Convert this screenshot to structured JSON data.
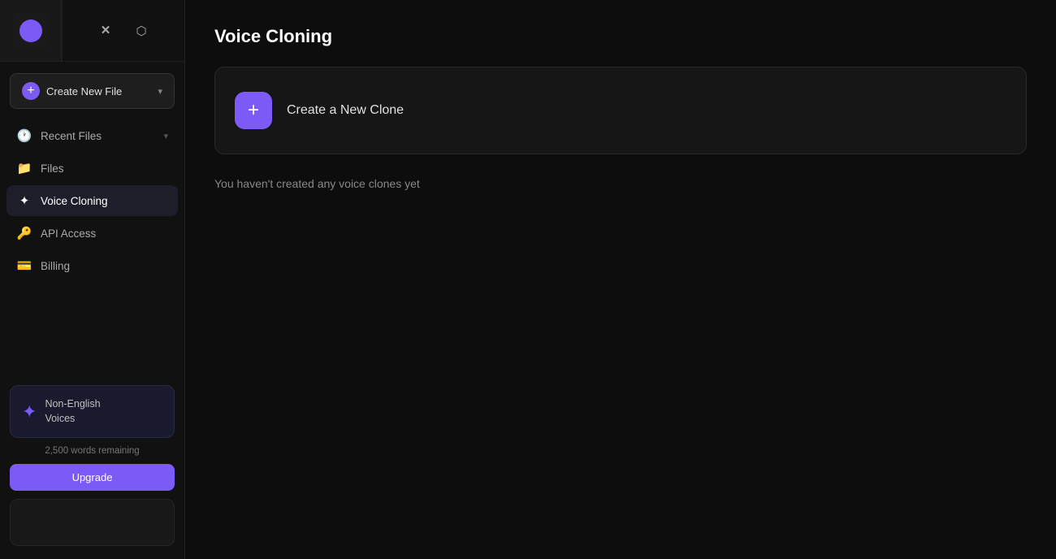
{
  "sidebar": {
    "logo": {
      "alt": "App Logo"
    },
    "social": {
      "twitter_label": "Twitter / X",
      "discord_label": "Discord"
    },
    "create_button": {
      "label": "Create New File",
      "plus_symbol": "+",
      "chevron": "▾"
    },
    "nav_items": [
      {
        "id": "recent-files",
        "label": "Recent Files",
        "icon": "🕐",
        "has_chevron": true,
        "active": false
      },
      {
        "id": "files",
        "label": "Files",
        "icon": "📁",
        "has_chevron": false,
        "active": false
      },
      {
        "id": "voice-cloning",
        "label": "Voice Cloning",
        "icon": "✦",
        "has_chevron": false,
        "active": true
      },
      {
        "id": "api-access",
        "label": "API Access",
        "icon": "🔑",
        "has_chevron": false,
        "active": false
      },
      {
        "id": "billing",
        "label": "Billing",
        "icon": "💳",
        "has_chevron": false,
        "active": false
      }
    ],
    "promo": {
      "icon": "✦",
      "line1": "Non-English",
      "line2": "Voices"
    },
    "words_remaining": "2,500 words remaining",
    "upgrade_label": "Upgrade"
  },
  "main": {
    "title": "Voice Cloning",
    "create_clone_label": "Create a New Clone",
    "plus_symbol": "+",
    "empty_state": "You haven't created any voice clones yet"
  }
}
